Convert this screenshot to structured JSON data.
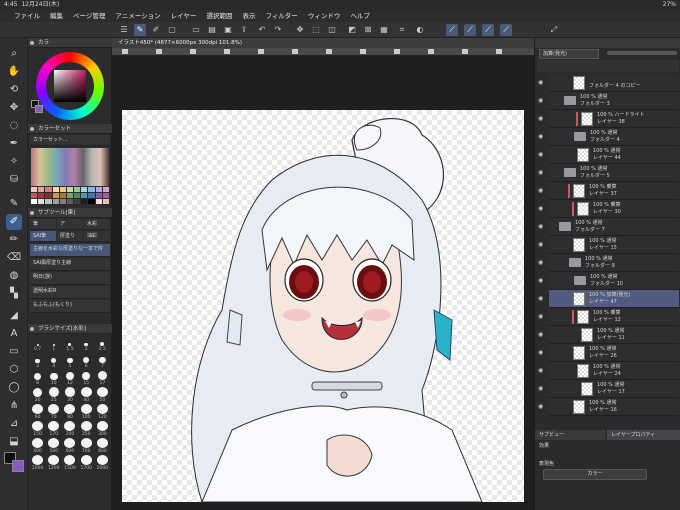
{
  "status": {
    "time": "4:45",
    "date": "12月24日(木)",
    "battery": "27%"
  },
  "menu": [
    "ファイル",
    "編集",
    "ページ管理",
    "アニメーション",
    "レイヤー",
    "選択範囲",
    "表示",
    "フィルター",
    "ウィンドウ",
    "ヘルプ"
  ],
  "canvas": {
    "tab_label": "イラスト450* (4877×6000px 300dpi 101.8%)"
  },
  "left": {
    "color_panel_label": "カラ",
    "colorset_label": "カラーセット",
    "colorset_name": "カラーセット...",
    "subtool_label": "サブツール[筆]",
    "subtool_tabs": [
      "筆",
      "ア",
      "水彩"
    ],
    "subtool_tabs2": [
      "SAI筆",
      "厚塗り",
      "油彩"
    ],
    "brushes": [
      "主線を水彩な厚塗りな一本で吟",
      "SAI風厚塗り主線",
      "明日(誤)",
      "透明水彩R",
      "もふもふ(もくり)"
    ],
    "brushsize_label": "ブラシサイズ[水彩]",
    "brush_sizes": [
      "0.7",
      "1",
      "1.5",
      "2",
      "2.5",
      "3",
      "4",
      "5",
      "6",
      "7",
      "8",
      "10",
      "12",
      "15",
      "17",
      "20",
      "25",
      "30",
      "40",
      "50",
      "60",
      "70",
      "80",
      "100",
      "120",
      "150",
      "170",
      "200",
      "250",
      "300",
      "400",
      "500",
      "600",
      "700",
      "800",
      "1000",
      "1200",
      "1500",
      "1700",
      "2000"
    ]
  },
  "right": {
    "blend_mode": "加算(発光)",
    "layers": [
      {
        "mode": "",
        "name": "フォルダー 4 のコピー",
        "type": "layer"
      },
      {
        "mode": "100 % 通常",
        "name": "フォルダー 3",
        "type": "folder"
      },
      {
        "mode": "100 % ハードライト",
        "name": "レイヤー 38",
        "type": "layer"
      },
      {
        "mode": "100 % 通常",
        "name": "フォルダー 4",
        "type": "folder"
      },
      {
        "mode": "100 % 通常",
        "name": "レイヤー 44",
        "type": "layer"
      },
      {
        "mode": "100 % 通常",
        "name": "フォルダー 5",
        "type": "folder"
      },
      {
        "mode": "100 % 乗算",
        "name": "レイヤー 37",
        "type": "layer"
      },
      {
        "mode": "100 % 乗算",
        "name": "レイヤー 30",
        "type": "layer"
      },
      {
        "mode": "100 % 通常",
        "name": "フォルダー 7",
        "type": "folder"
      },
      {
        "mode": "100 % 通常",
        "name": "レイヤー 15",
        "type": "layer"
      },
      {
        "mode": "100 % 通常",
        "name": "フォルダー 9",
        "type": "folder"
      },
      {
        "mode": "100 % 通常",
        "name": "フォルダー 10",
        "type": "folder"
      },
      {
        "mode": "100 % 加算(発光)",
        "name": "レイヤー 47",
        "type": "layer"
      },
      {
        "mode": "100 % 乗算",
        "name": "レイヤー 12",
        "type": "layer"
      },
      {
        "mode": "100 % 通常",
        "name": "レイヤー 11",
        "type": "layer"
      },
      {
        "mode": "100 % 通常",
        "name": "レイヤー 26",
        "type": "layer"
      },
      {
        "mode": "100 % 通常",
        "name": "レイヤー 24",
        "type": "layer"
      },
      {
        "mode": "100 % 通常",
        "name": "レイヤー 17",
        "type": "layer"
      },
      {
        "mode": "100 % 通常",
        "name": "レイヤー 16",
        "type": "layer"
      }
    ],
    "bottom_tabs": [
      "サブビュー",
      "レイヤープロパティ"
    ],
    "effect_label": "効果",
    "expression_label": "表現色",
    "expression_value": "カラー"
  }
}
